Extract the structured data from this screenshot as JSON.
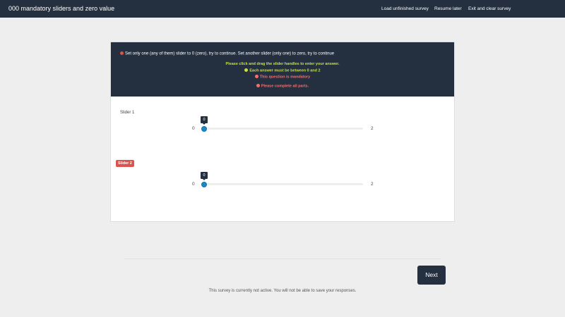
{
  "header": {
    "survey_title": "000 mandatory sliders and zero value",
    "nav": {
      "load_unfinished": "Load unfinished survey",
      "resume_later": "Resume later",
      "exit_clear": "Exit and clear survey"
    }
  },
  "question": {
    "text": "Set only one (any of them) slider to 0 (zero), try to continue. Set another slider (only one) to zero, try to continue",
    "tips": {
      "drag_hint": "Please click and drag the slider handles to enter your answer.",
      "range_hint": "Each answer must be between 0 and 2",
      "mandatory": "This question is mandatory",
      "complete_all": "Please complete all parts."
    }
  },
  "sliders": [
    {
      "label": "Slider 1",
      "min": "0",
      "max": "2",
      "value": "0",
      "error": false
    },
    {
      "label": "Slider 2",
      "min": "0",
      "max": "2",
      "value": "0",
      "error": true
    }
  ],
  "footer": {
    "next_label": "Next",
    "inactive_note": "This survey is currently not active. You will not be able to save your responses."
  },
  "colors": {
    "navbar": "#243040",
    "error": "#d9534f",
    "tip_green": "#c6e03a",
    "handle": "#1b87c9"
  }
}
